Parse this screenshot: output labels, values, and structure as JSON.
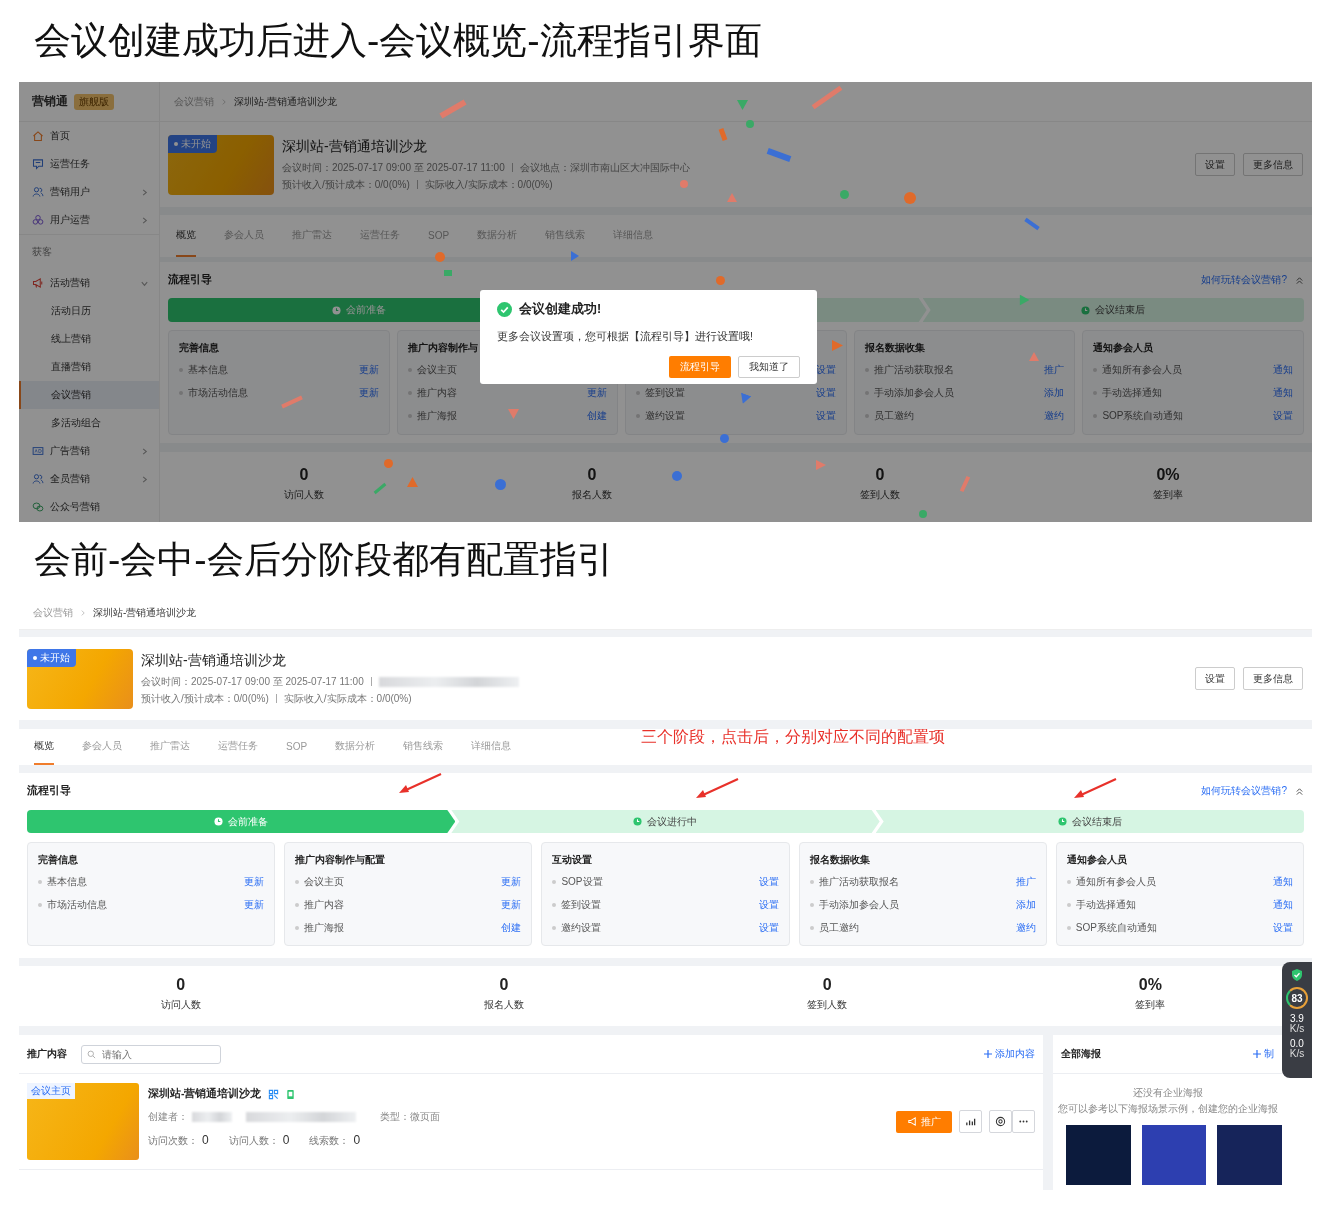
{
  "sections": [
    {
      "caption": "会议创建成功后进入-会议概览-流程指引界面",
      "screenshot": {
        "sidebar": {
          "brand": "营销通",
          "badge": "旗舰版",
          "items": [
            {
              "kind": "link",
              "label": "首页",
              "selected": false
            },
            {
              "kind": "link",
              "label": "运营任务",
              "selected": false
            },
            {
              "kind": "link",
              "label": "营销用户",
              "expanded": false,
              "selected": false
            },
            {
              "kind": "link",
              "label": "用户运营",
              "expanded": false,
              "selected": false
            },
            {
              "kind": "section",
              "label": "获客"
            },
            {
              "kind": "link",
              "label": "活动营销",
              "expanded": true,
              "selected": false,
              "children": [
                {
                  "label": "活动日历",
                  "selected": false
                },
                {
                  "label": "线上营销",
                  "selected": false
                },
                {
                  "label": "直播营销",
                  "selected": false
                },
                {
                  "label": "会议营销",
                  "selected": true
                },
                {
                  "label": "多活动组合",
                  "selected": false
                }
              ]
            },
            {
              "kind": "link",
              "label": "广告营销",
              "expanded": false,
              "selected": false
            },
            {
              "kind": "link",
              "label": "全员营销",
              "expanded": false,
              "selected": false
            },
            {
              "kind": "link",
              "label": "公众号营销",
              "selected": false
            }
          ]
        },
        "breadcrumb": [
          "会议营销",
          "深圳站-营销通培训沙龙"
        ],
        "event": {
          "status": "未开始",
          "title": "深圳站-营销通培训沙龙",
          "meta": [
            [
              {
                "kind": "text",
                "text": "会议时间：2025-07-17 09:00 至 2025-07-17 11:00"
              },
              {
                "kind": "text",
                "text": "会议地点：深圳市南山区大冲国际中心"
              }
            ],
            [
              {
                "kind": "text",
                "text": "预计收入/预计成本：0/0(0%)"
              },
              {
                "kind": "text",
                "text": "实际收入/实际成本：0/0(0%)"
              }
            ]
          ]
        },
        "header_buttons": [
          "设置",
          "更多信息"
        ],
        "tabs": [
          {
            "label": "概览",
            "selected": true
          },
          {
            "label": "参会人员",
            "selected": false
          },
          {
            "label": "推广雷达",
            "selected": false
          },
          {
            "label": "运营任务",
            "selected": false
          },
          {
            "label": "SOP",
            "selected": false
          },
          {
            "label": "数据分析",
            "selected": false
          },
          {
            "label": "销售线索",
            "selected": false
          },
          {
            "label": "详细信息",
            "selected": false
          }
        ],
        "flow": {
          "title": "流程引导",
          "help_link": "如何玩转会议营销?",
          "stages": [
            {
              "label": "会前准备",
              "selected": true
            },
            {
              "selected": false
            },
            {
              "label": "会议结束后",
              "selected": false
            }
          ],
          "cards": [
            {
              "title": "完善信息",
              "items": [
                {
                  "label": "基本信息",
                  "action": "更新"
                },
                {
                  "label": "市场活动信息",
                  "action": "更新"
                }
              ]
            },
            {
              "title": "推广内容制作与",
              "items": [
                {
                  "label": "会议主页"
                },
                {
                  "label": "推广内容",
                  "action": "更新"
                },
                {
                  "label": "推广海报",
                  "action": "创建"
                }
              ]
            },
            {
              "items": [
                {
                  "action": "设置"
                },
                {
                  "label": "签到设置",
                  "action": "设置"
                },
                {
                  "label": "邀约设置",
                  "action": "设置"
                }
              ]
            },
            {
              "title": "报名数据收集",
              "items": [
                {
                  "label": "推广活动获取报名",
                  "action": "推广"
                },
                {
                  "label": "手动添加参会人员",
                  "action": "添加"
                },
                {
                  "label": "员工邀约",
                  "action": "邀约"
                }
              ]
            },
            {
              "title": "通知参会人员",
              "items": [
                {
                  "label": "通知所有参会人员",
                  "action": "通知"
                },
                {
                  "label": "手动选择通知",
                  "action": "通知"
                },
                {
                  "label": "SOP系统自动通知",
                  "action": "设置"
                }
              ]
            }
          ]
        },
        "stats": [
          {
            "value": "0",
            "label": "访问人数"
          },
          {
            "value": "0",
            "label": "报名人数"
          },
          {
            "value": "0",
            "label": "签到人数"
          },
          {
            "value": "0%",
            "label": "签到率"
          }
        ],
        "modal": {
          "title": "会议创建成功!",
          "message": "更多会议设置项，您可根据【流程引导】进行设置哦!",
          "primary": "流程引导",
          "secondary": "我知道了"
        }
      }
    },
    {
      "caption": "会前-会中-会后分阶段都有配置指引",
      "screenshot": {
        "breadcrumb": [
          "会议营销",
          "深圳站-营销通培训沙龙"
        ],
        "event": {
          "status": "未开始",
          "title": "深圳站-营销通培训沙龙",
          "meta": [
            [
              {
                "kind": "text",
                "text": "会议时间：2025-07-17 09:00 至 2025-07-17 11:00"
              },
              {
                "kind": "blurred"
              }
            ],
            [
              {
                "kind": "text",
                "text": "预计收入/预计成本：0/0(0%)"
              },
              {
                "kind": "text",
                "text": "实际收入/实际成本：0/0(0%)"
              }
            ]
          ]
        },
        "header_buttons": [
          "设置",
          "更多信息"
        ],
        "tabs": [
          {
            "label": "概览",
            "selected": true
          },
          {
            "label": "参会人员",
            "selected": false
          },
          {
            "label": "推广雷达",
            "selected": false
          },
          {
            "label": "运营任务",
            "selected": false
          },
          {
            "label": "SOP",
            "selected": false
          },
          {
            "label": "数据分析",
            "selected": false
          },
          {
            "label": "销售线索",
            "selected": false
          },
          {
            "label": "详细信息",
            "selected": false
          }
        ],
        "annotation": "三个阶段，点击后，分别对应不同的配置项",
        "flow": {
          "title": "流程引导",
          "help_link": "如何玩转会议营销?",
          "stages": [
            {
              "label": "会前准备",
              "selected": true
            },
            {
              "label": "会议进行中",
              "selected": false
            },
            {
              "label": "会议结束后",
              "selected": false
            }
          ],
          "cards": [
            {
              "title": "完善信息",
              "items": [
                {
                  "label": "基本信息",
                  "action": "更新"
                },
                {
                  "label": "市场活动信息",
                  "action": "更新"
                }
              ]
            },
            {
              "title": "推广内容制作与配置",
              "items": [
                {
                  "label": "会议主页",
                  "action": "更新"
                },
                {
                  "label": "推广内容",
                  "action": "更新"
                },
                {
                  "label": "推广海报",
                  "action": "创建"
                }
              ]
            },
            {
              "title": "互动设置",
              "items": [
                {
                  "label": "SOP设置",
                  "action": "设置"
                },
                {
                  "label": "签到设置",
                  "action": "设置"
                },
                {
                  "label": "邀约设置",
                  "action": "设置"
                }
              ]
            },
            {
              "title": "报名数据收集",
              "items": [
                {
                  "label": "推广活动获取报名",
                  "action": "推广"
                },
                {
                  "label": "手动添加参会人员",
                  "action": "添加"
                },
                {
                  "label": "员工邀约",
                  "action": "邀约"
                }
              ]
            },
            {
              "title": "通知参会人员",
              "items": [
                {
                  "label": "通知所有参会人员",
                  "action": "通知"
                },
                {
                  "label": "手动选择通知",
                  "action": "通知"
                },
                {
                  "label": "SOP系统自动通知",
                  "action": "设置"
                }
              ]
            }
          ]
        },
        "stats": [
          {
            "value": "0",
            "label": "访问人数"
          },
          {
            "value": "0",
            "label": "报名人数"
          },
          {
            "value": "0",
            "label": "签到人数"
          },
          {
            "value": "0%",
            "label": "签到率"
          }
        ],
        "promo": {
          "title": "推广内容",
          "search_placeholder": "请输入",
          "add": "添加内容",
          "items": [
            {
              "tag": "会议主页",
              "title": "深圳站-营销通培训沙龙",
              "creator_label": "创建者：",
              "type": "类型：微页面",
              "promote": "推广",
              "counts": [
                {
                  "label": "访问次数：",
                  "value": "0"
                },
                {
                  "label": "访问人数：",
                  "value": "0"
                },
                {
                  "label": "线索数：",
                  "value": "0"
                }
              ]
            }
          ]
        },
        "posters": {
          "title": "全部海报",
          "make": "制",
          "empty_title": "还没有企业海报",
          "empty_hint": "您可以参考以下海报场景示例，创建您的企业海报"
        },
        "monitor": {
          "score": "83",
          "upload": "3.9",
          "upload_unit": "K/s",
          "download": "0.0",
          "download_unit": "K/s"
        }
      }
    }
  ]
}
